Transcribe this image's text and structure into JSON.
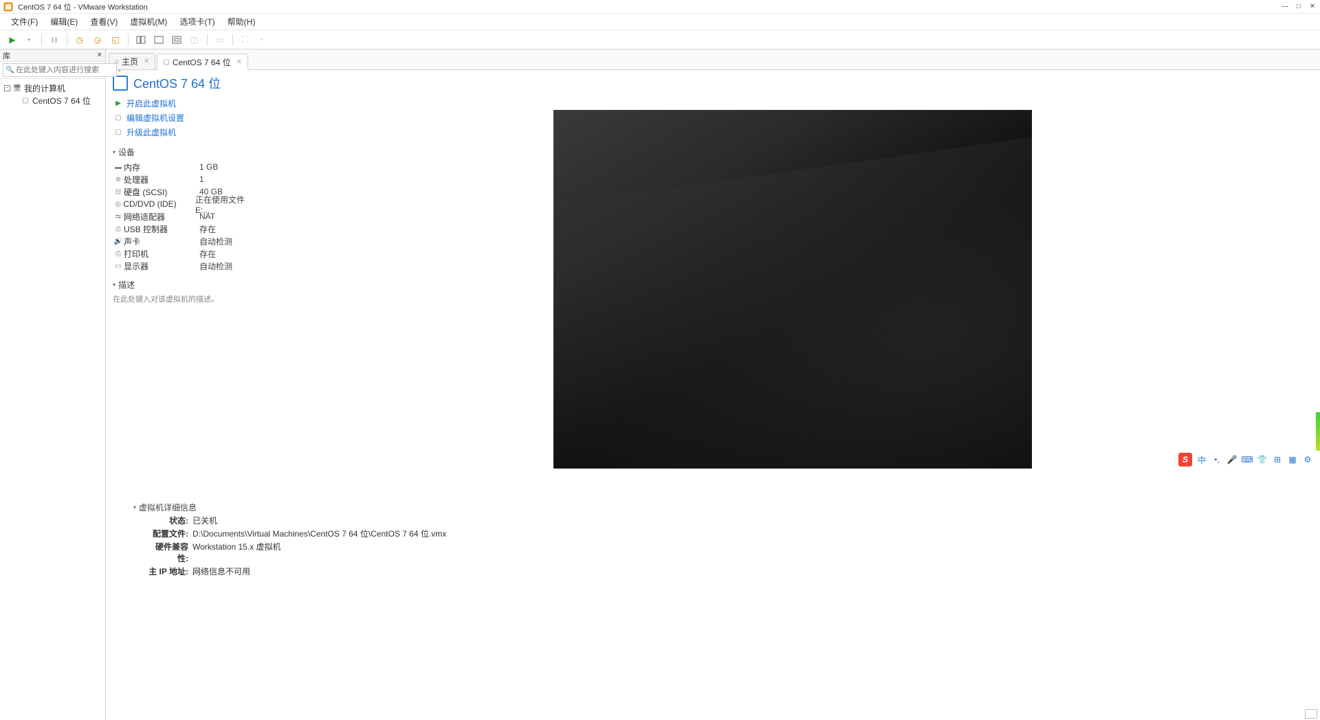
{
  "window": {
    "title": "CentOS 7 64 位 - VMware Workstation"
  },
  "menus": {
    "file": "文件(F)",
    "edit": "编辑(E)",
    "view": "查看(V)",
    "vm": "虚拟机(M)",
    "tabs": "选项卡(T)",
    "help": "帮助(H)"
  },
  "library": {
    "title": "库",
    "search_placeholder": "在此处键入内容进行搜索",
    "root": "我的计算机",
    "child": "CentOS 7 64 位"
  },
  "tabs": {
    "home": "主页",
    "vm": "CentOS 7 64 位"
  },
  "vm": {
    "title": "CentOS 7 64 位",
    "actions": {
      "power_on": "开启此虚拟机",
      "edit_settings": "编辑虚拟机设置",
      "upgrade": "升级此虚拟机"
    },
    "devices_head": "设备",
    "devices": [
      {
        "icon": "memory-icon",
        "name": "内存",
        "value": "1 GB"
      },
      {
        "icon": "cpu-icon",
        "name": "处理器",
        "value": "1"
      },
      {
        "icon": "disk-icon",
        "name": "硬盘 (SCSI)",
        "value": "40 GB"
      },
      {
        "icon": "disc-icon",
        "name": "CD/DVD (IDE)",
        "value": "正在使用文件 E:..."
      },
      {
        "icon": "network-icon",
        "name": "网络适配器",
        "value": "NAT"
      },
      {
        "icon": "usb-icon",
        "name": "USB 控制器",
        "value": "存在"
      },
      {
        "icon": "sound-icon",
        "name": "声卡",
        "value": "自动检测"
      },
      {
        "icon": "printer-icon",
        "name": "打印机",
        "value": "存在"
      },
      {
        "icon": "display-icon",
        "name": "显示器",
        "value": "自动检测"
      }
    ],
    "desc_head": "描述",
    "desc_placeholder": "在此处键入对该虚拟机的描述。",
    "details_head": "虚拟机详细信息",
    "details": {
      "state_lbl": "状态:",
      "state_val": "已关机",
      "config_lbl": "配置文件:",
      "config_val": "D:\\Documents\\Virtual Machines\\CentOS 7 64 位\\CentOS 7 64 位.vmx",
      "compat_lbl": "硬件兼容性:",
      "compat_val": "Workstation 15.x 虚拟机",
      "ip_lbl": "主 IP 地址:",
      "ip_val": "网络信息不可用"
    }
  },
  "ime": {
    "lang": "中"
  }
}
